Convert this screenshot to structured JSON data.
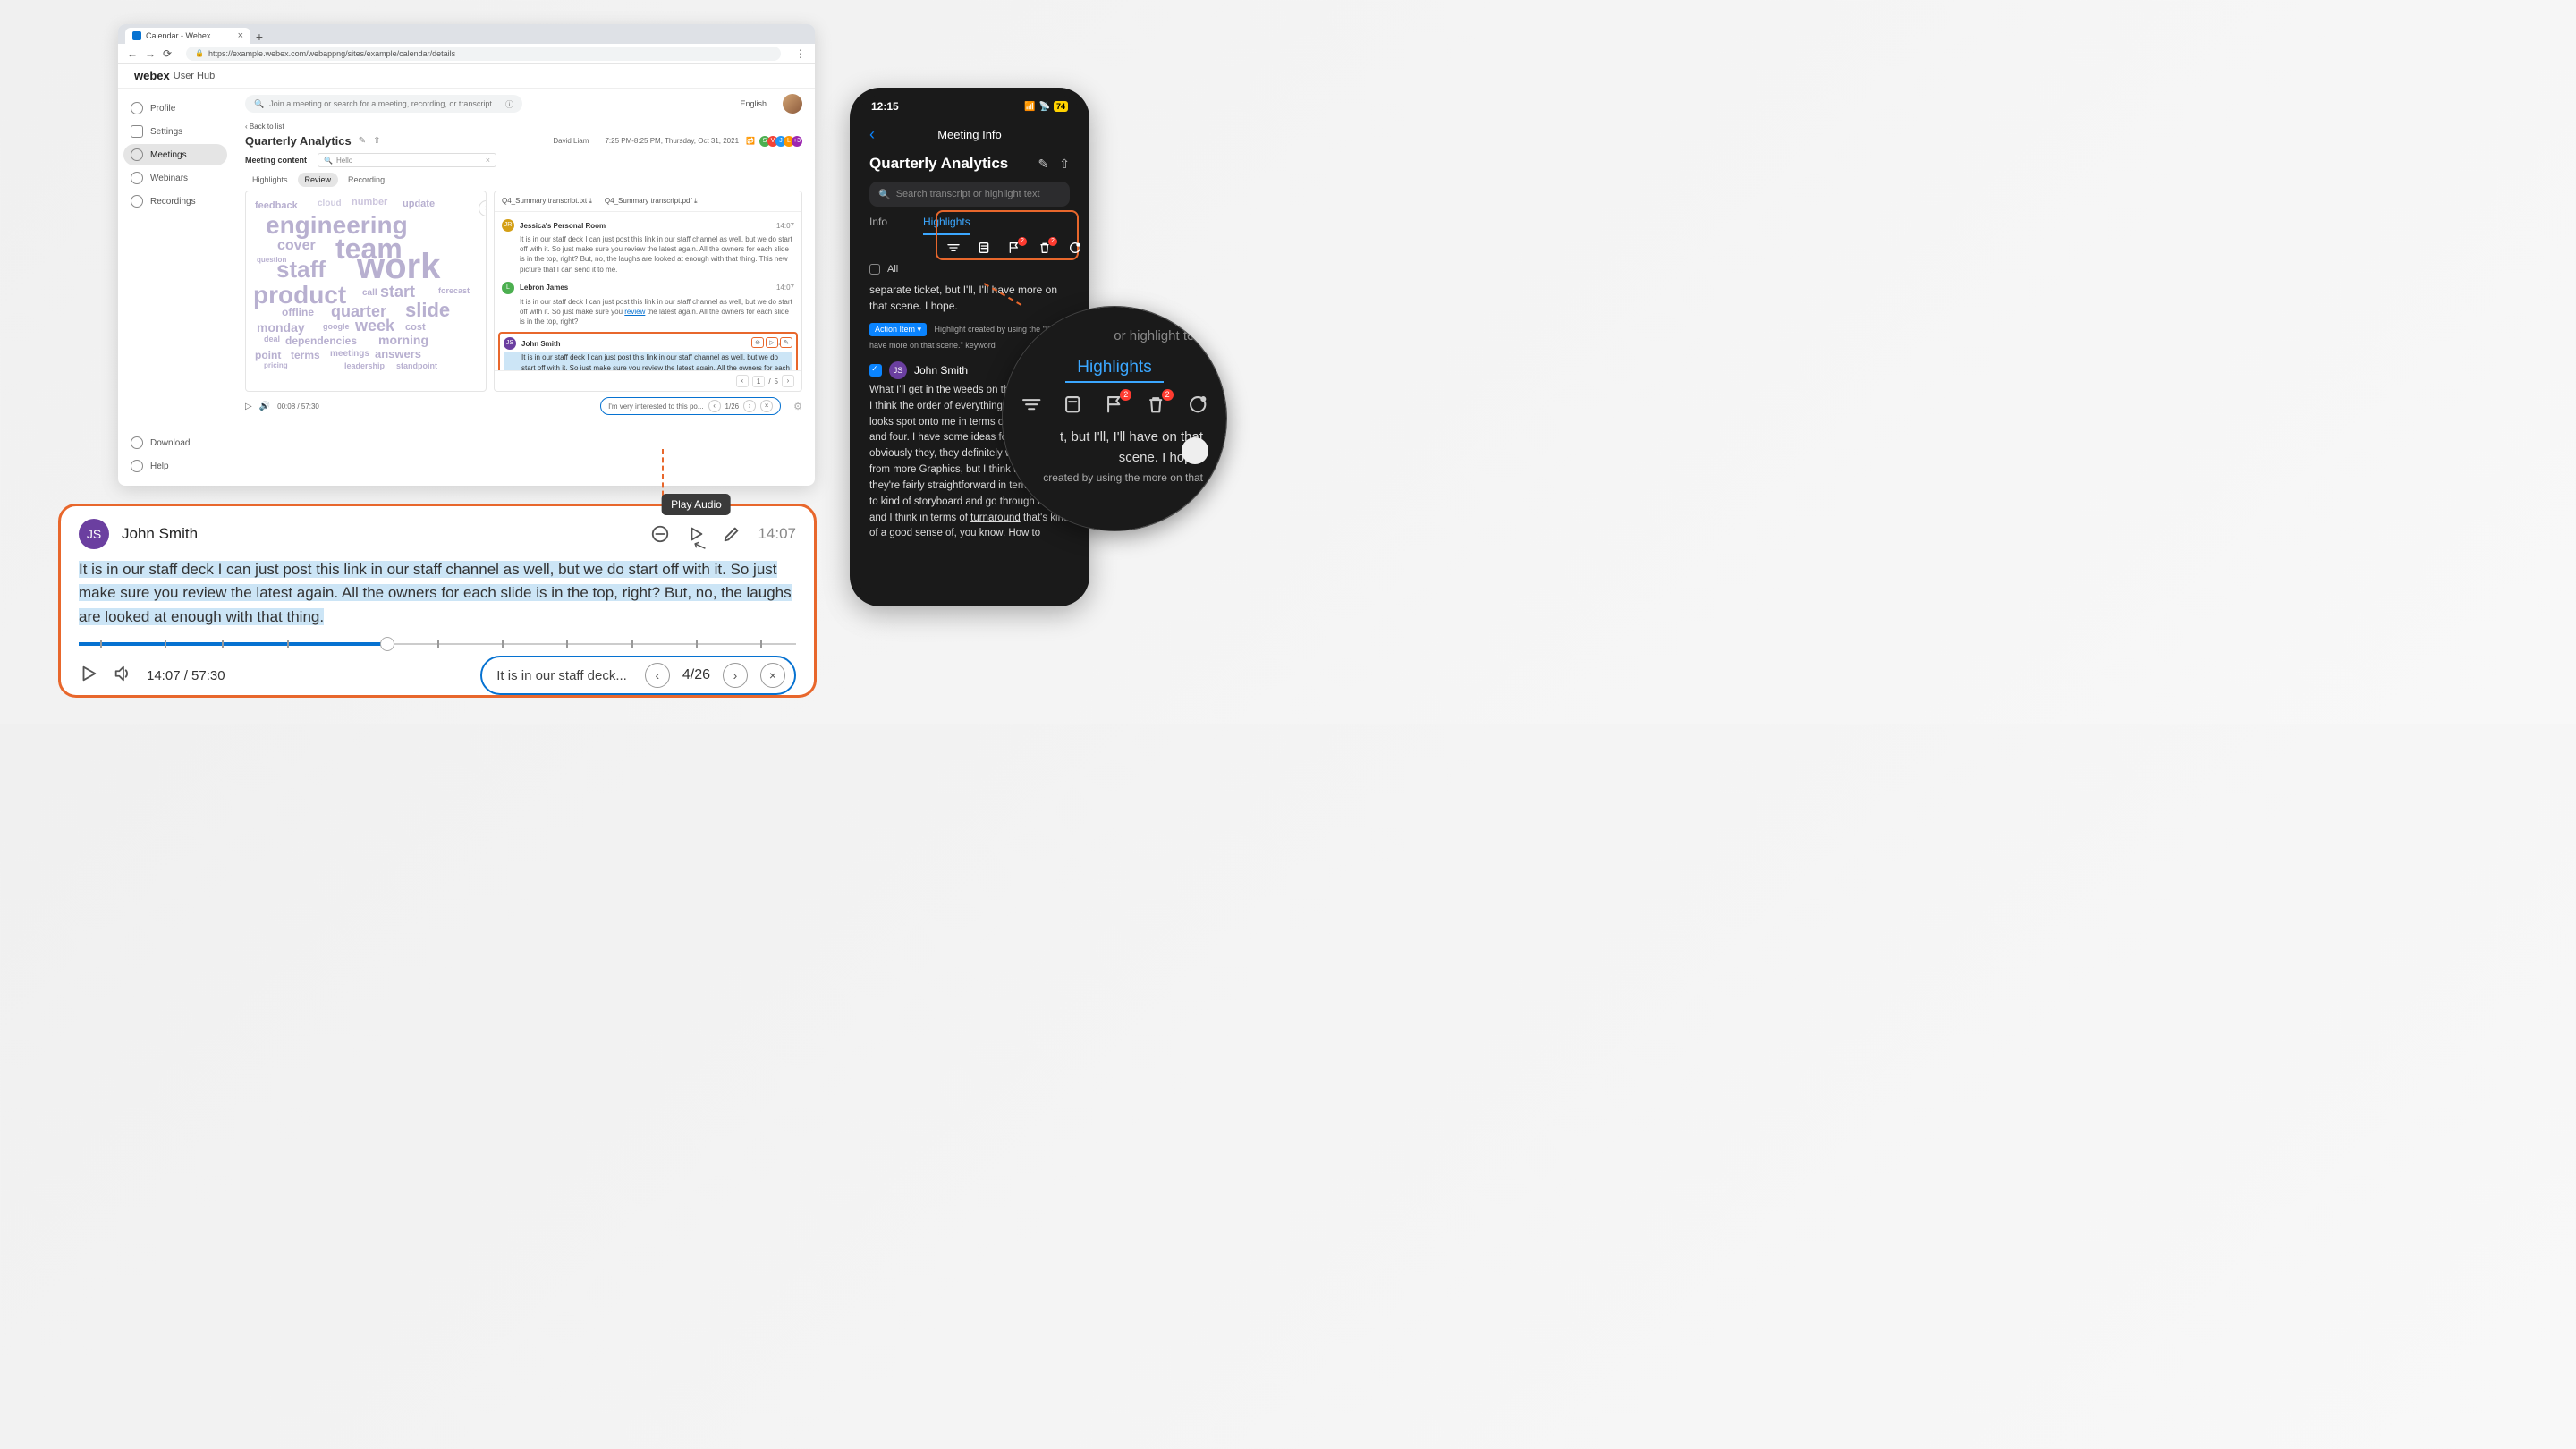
{
  "browser": {
    "tab_title": "Calendar - Webex",
    "url": "https://example.webex.com/webappng/sites/example/calendar/details"
  },
  "app": {
    "brand": "webex",
    "brand_sub": "User Hub",
    "search_placeholder": "Join a meeting or search for a meeting, recording, or transcript",
    "language": "English"
  },
  "sidebar": {
    "items": [
      {
        "label": "Profile"
      },
      {
        "label": "Settings"
      },
      {
        "label": "Meetings"
      },
      {
        "label": "Webinars"
      },
      {
        "label": "Recordings"
      }
    ],
    "download": "Download",
    "help": "Help"
  },
  "meeting": {
    "back": "Back to list",
    "title": "Quarterly Analytics",
    "host": "David Liam",
    "time": "7:25 PM-8:25 PM, Thursday, Oct 31, 2021",
    "content_label": "Meeting content",
    "content_search": "Hello",
    "tabs": [
      "Highlights",
      "Review",
      "Recording"
    ],
    "downloads": [
      "Q4_Summary transcript.txt ⤓",
      "Q4_Summary transcript.pdf ⤓"
    ],
    "speakers": [
      {
        "ava": "JR",
        "color": "#d4a017",
        "name": "Jessica's Personal Room",
        "time": "14:07",
        "text": "It is in our staff deck I can just post this link in our staff channel as well, but we do start off with it. So just make sure you review the latest again. All the owners for each slide is in the top, right? But, no, the laughs are looked at enough with that thing. This new picture that I can send it to me."
      },
      {
        "ava": "L",
        "color": "#4caf50",
        "name": "Lebron James",
        "time": "14:07",
        "text": "It is in our staff deck I can just post this link in our staff channel as well, but we do start off with it. So just make sure you <span class='link-w'>review</span> the latest again. All the owners for each slide is in the top, right?"
      },
      {
        "ava": "JS",
        "color": "#6b3fa0",
        "name": "John Smith",
        "time": "14:07",
        "text": "It is in our staff deck I can just post this link in our staff channel as well, but we do start off with it. So just make sure you review the latest again. All the owners for each slide is in the top, right? But, no, the laughs are looked at enough with that thing."
      }
    ],
    "pager": {
      "current": "1",
      "total": "5"
    },
    "player_time": "00:08 / 57:30",
    "find_text": "I'm very interested to this po...",
    "find_count": "1/26"
  },
  "wordcloud": [
    "feedback",
    "cloud",
    "number",
    "update",
    "engineering",
    "cover",
    "team",
    "question",
    "staff",
    "work",
    "product",
    "call",
    "start",
    "offline",
    "quarter",
    "slide",
    "monday",
    "google",
    "week",
    "cost",
    "deal",
    "dependencies",
    "morning",
    "point",
    "terms",
    "meetings",
    "answers",
    "leadership",
    "standpoint",
    "pricing",
    "forecast"
  ],
  "callout": {
    "ava": "JS",
    "name": "John Smith",
    "time": "14:07",
    "tooltip": "Play Audio",
    "text_hl": "It is in our staff deck I can just post this link in our staff channel as well, but we do start off with it. So just make sure you review the latest again. All the owners for each slide is in the top, right? But, no, the laughs are looked at enough with that thing.",
    "player_time": "14:07 / 57:30",
    "find": "It is in our staff deck...",
    "find_count": "4/26"
  },
  "phone": {
    "clock": "12:15",
    "battery": "74",
    "header": "Meeting Info",
    "title": "Quarterly Analytics",
    "search": "Search transcript or highlight text",
    "tabs": [
      "Info",
      "Highlights"
    ],
    "all": "All",
    "snippet1": "separate ticket, but I'll, I'll have more on that scene. I hope.",
    "action_label": "Action Item ▾",
    "action_text": "Highlight created by using the \"I'll, I'll have more on that scene.\" keyword",
    "speaker": {
      "ava": "JS",
      "name": "John Smith"
    },
    "text": "What I'll get in the weeds on this other stuff, I think the order of everything else on here looks spot onto me in terms of two, three and four. I have some ideas for four, I think, obviously they, they definitely will benefit from more Graphics, but I think they're, they're fairly straightforward in terms of how to kind of storyboard and go through them and I think in terms of turnaround that's kind of a good sense of, you know. How to",
    "badge_count": "2"
  },
  "magnifier": {
    "search_hint": "or highlight text",
    "tab": "Highlights",
    "text_line": "t, but I'll, I'll have on that scene. I hope.",
    "sub": "created by using the more on that",
    "badge": "2"
  }
}
